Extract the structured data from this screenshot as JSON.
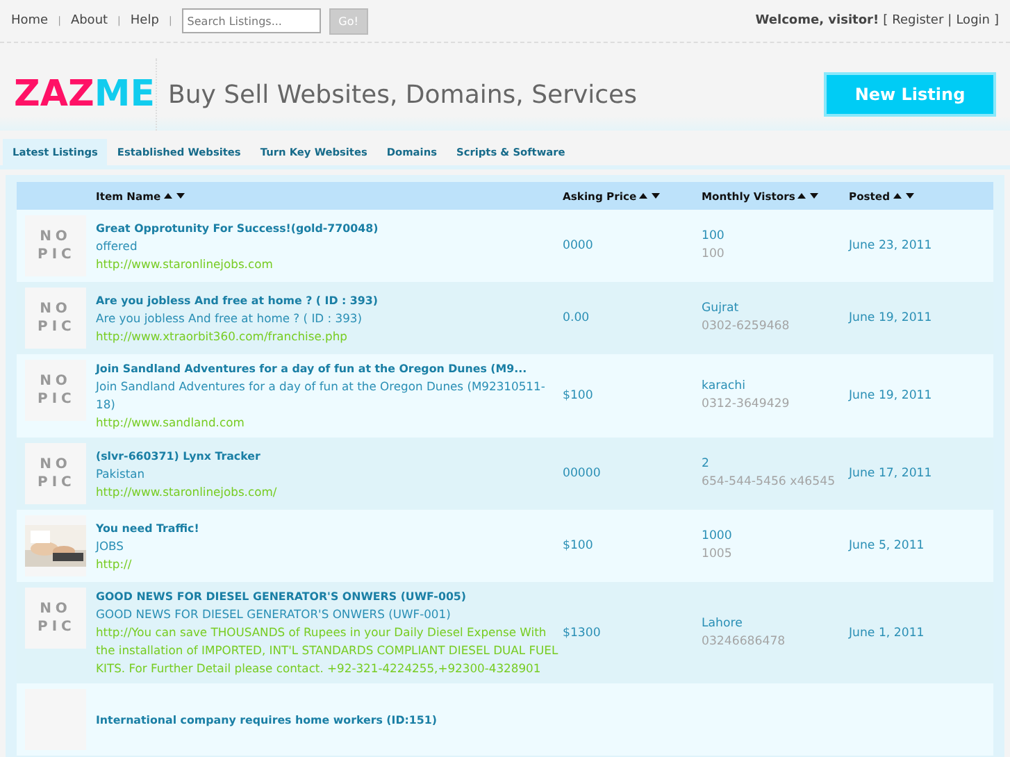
{
  "top_nav": {
    "links": [
      "Home",
      "About",
      "Help"
    ],
    "separator": "|",
    "search": {
      "placeholder": "Search Listings..."
    },
    "go_button": "Go!",
    "welcome": "Welcome, visitor!",
    "brackets": [
      "[",
      "]"
    ],
    "account_links": [
      "Register",
      "Login"
    ]
  },
  "header": {
    "logo": [
      {
        "text": "ZAZ",
        "color": "#ff1166"
      },
      {
        "text": "ME",
        "color": "#11ccee"
      }
    ],
    "tagline": "Buy Sell Websites, Domains, Services",
    "new_listing_button": "New Listing"
  },
  "tabs": [
    {
      "label": "Latest Listings",
      "selected": true
    },
    {
      "label": "Established Websites",
      "selected": false
    },
    {
      "label": "Turn Key Websites",
      "selected": false
    },
    {
      "label": "Domains",
      "selected": false
    },
    {
      "label": "Scripts & Software",
      "selected": false
    }
  ],
  "table": {
    "columns": [
      "Item Name",
      "Asking Price",
      "Monthly Vistors",
      "Posted"
    ],
    "rows": [
      {
        "kind": "nopic",
        "thumb_text": "NO PIC",
        "title": "Great Opprotunity For Success!(gold-770048)",
        "description": "offered",
        "url": "http://www.staronlinejobs.com",
        "price": "0000",
        "visitors": "100",
        "contact": "100",
        "posted": "June 23, 2011"
      },
      {
        "kind": "nopic",
        "thumb_text": "NO PIC",
        "title": "Are you jobless And free at home ? ( ID : 393)",
        "description": "Are you jobless And free at home ? ( ID : 393)",
        "url": "http://www.xtraorbit360.com/franchise.php",
        "price": "0.00",
        "visitors": "Gujrat",
        "contact": "0302-6259468",
        "posted": "June 19, 2011"
      },
      {
        "kind": "nopic",
        "thumb_text": "NO PIC",
        "title": "Join Sandland Adventures for a day of fun at the Oregon Dunes (M9...",
        "description": "Join Sandland Adventures for a day of fun at the Oregon Dunes (M92310511-18)",
        "url": "http://www.sandland.com",
        "price": "$100",
        "visitors": "karachi",
        "contact": "0312-3649429",
        "posted": "June 19, 2011"
      },
      {
        "kind": "nopic",
        "thumb_text": "NO PIC",
        "title": "(slvr-660371) Lynx Tracker",
        "description": "Pakistan",
        "url": "http://www.staronlinejobs.com/",
        "price": "00000",
        "visitors": "2",
        "contact": "654-544-5456 x46545",
        "posted": "June 17, 2011"
      },
      {
        "kind": "picture",
        "title": "You need Traffic!",
        "description": "JOBS",
        "url": "http://",
        "price": "$100",
        "visitors": "1000",
        "contact": "1005",
        "posted": "June 5, 2011"
      },
      {
        "kind": "nopic",
        "thumb_text": "NO PIC",
        "title": "GOOD NEWS FOR DIESEL GENERATOR'S ONWERS (UWF-005)",
        "description": "GOOD NEWS FOR DIESEL GENERATOR'S ONWERS (UWF-001)",
        "url": "http://You can save THOUSANDS of Rupees in your Daily Diesel Expense With the installation of IMPORTED, INT'L STANDARDS COMPLIANT DIESEL DUAL FUEL KITS. For Further Detail please contact. +92-321-4224255,+92300-4328901",
        "price": "$1300",
        "visitors": "Lahore",
        "contact": "03246686478",
        "posted": "June 1, 2011"
      },
      {
        "kind": "blank",
        "title": "International company requires home workers (ID:151)"
      }
    ]
  }
}
